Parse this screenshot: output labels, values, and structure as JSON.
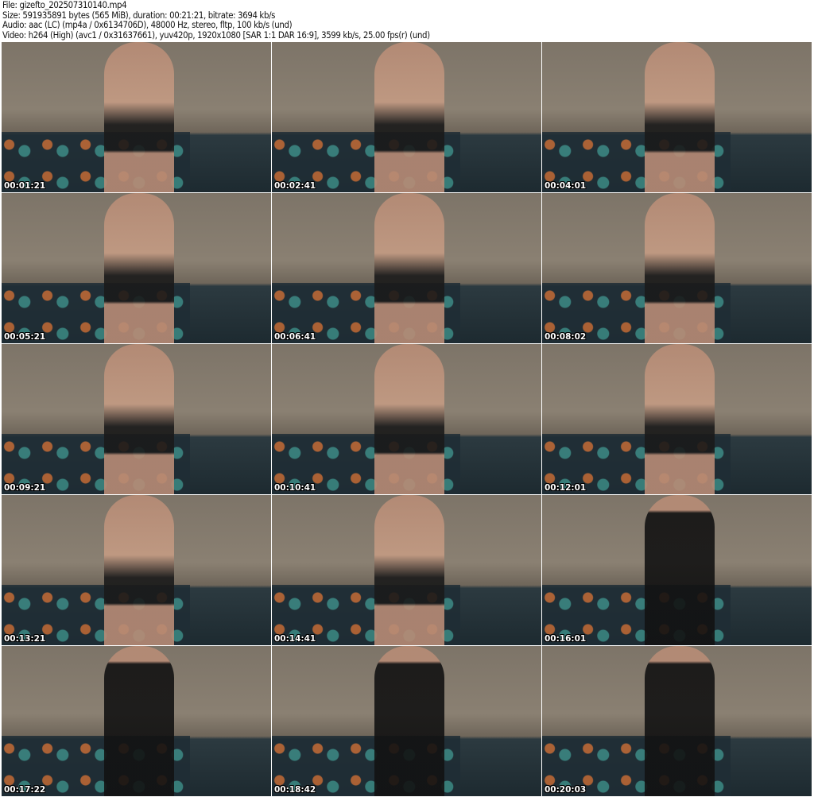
{
  "header": {
    "file": "File: gizefto_202507310140.mp4",
    "size": "Size: 591935891 bytes (565 MiB), duration: 00:21:21, bitrate: 3694 kb/s",
    "audio": "Audio: aac (LC) (mp4a / 0x6134706D), 48000 Hz, stereo, fltp, 100 kb/s (und)",
    "video": "Video: h264 (High) (avc1 / 0x31637661), yuv420p, 1920x1080 [SAR 1:1 DAR 16:9], 3599 kb/s, 25.00 fps(r) (und)"
  },
  "thumbnails": [
    {
      "timestamp": "00:01:21",
      "outfit": "light"
    },
    {
      "timestamp": "00:02:41",
      "outfit": "light"
    },
    {
      "timestamp": "00:04:01",
      "outfit": "light"
    },
    {
      "timestamp": "00:05:21",
      "outfit": "light"
    },
    {
      "timestamp": "00:06:41",
      "outfit": "light"
    },
    {
      "timestamp": "00:08:02",
      "outfit": "light"
    },
    {
      "timestamp": "00:09:21",
      "outfit": "light"
    },
    {
      "timestamp": "00:10:41",
      "outfit": "light"
    },
    {
      "timestamp": "00:12:01",
      "outfit": "light"
    },
    {
      "timestamp": "00:13:21",
      "outfit": "light"
    },
    {
      "timestamp": "00:14:41",
      "outfit": "light"
    },
    {
      "timestamp": "00:16:01",
      "outfit": "dark"
    },
    {
      "timestamp": "00:17:22",
      "outfit": "dark"
    },
    {
      "timestamp": "00:18:42",
      "outfit": "dark"
    },
    {
      "timestamp": "00:20:03",
      "outfit": "dark"
    }
  ]
}
